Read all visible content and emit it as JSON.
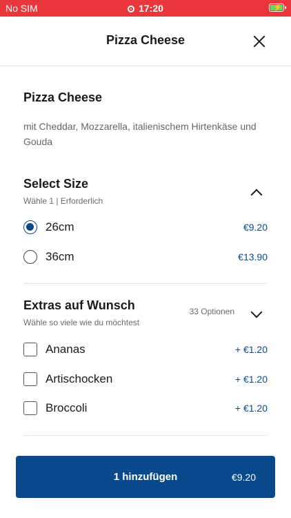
{
  "status_bar": {
    "carrier": "No SIM",
    "time": "17:20",
    "battery_icon": "battery-charging-icon"
  },
  "header": {
    "title": "Pizza Cheese",
    "close_icon": "close-icon"
  },
  "product": {
    "name": "Pizza Cheese",
    "description": "mit Cheddar, Mozzarella, italienischem Hirtenkäse und Gouda"
  },
  "size_section": {
    "title": "Select Size",
    "subtitle": "Wähle 1  |  Erforderlich",
    "options": [
      {
        "label": "26cm",
        "price": "€9.20",
        "selected": true
      },
      {
        "label": "36cm",
        "price": "€13.90",
        "selected": false
      }
    ]
  },
  "extras_section": {
    "title": "Extras auf Wunsch",
    "subtitle": "Wähle so viele wie du möchtest",
    "options_count": "33 Optionen",
    "options": [
      {
        "label": "Ananas",
        "price": "+ €1.20"
      },
      {
        "label": "Artischocken",
        "price": "+ €1.20"
      },
      {
        "label": "Broccoli",
        "price": "+ €1.20"
      }
    ]
  },
  "cta": {
    "label": "1 hinzufügen",
    "price": "€9.20"
  },
  "colors": {
    "status_bar": "#e8363a",
    "primary": "#0a4a8c"
  }
}
